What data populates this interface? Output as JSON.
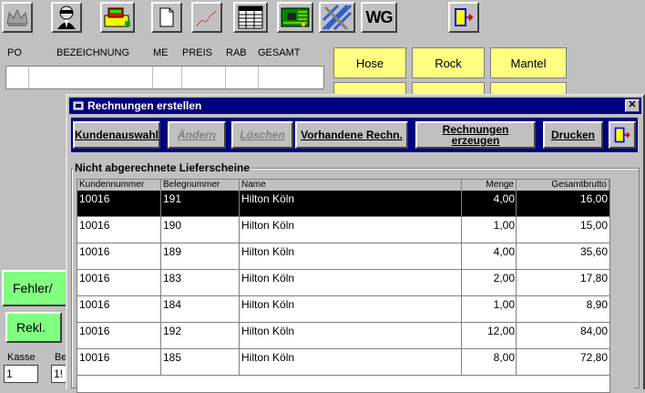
{
  "toolbar": {
    "icons": [
      "crown-icon",
      "agent-icon",
      "cash-register-icon",
      "document-icon",
      "chart-icon",
      "spreadsheet-icon",
      "circuit-icon",
      "layout-icon",
      "wg-button",
      "exit-door-icon"
    ],
    "wg_label": "WG"
  },
  "order_table": {
    "headers": [
      "PO",
      "BEZEICHNUNG",
      "ME",
      "PREIS",
      "RAB",
      "GESAMT"
    ]
  },
  "products": [
    "Hose",
    "Rock",
    "Mantel"
  ],
  "left_panel": {
    "fehler_label": "Fehler/",
    "rekl_label": "Rekl.",
    "kasse_label": "Kasse",
    "be_label": "Be",
    "kasse_value": "1",
    "be_value": "1!"
  },
  "dialog": {
    "title": "Rechnungen erstellen",
    "close_label": "✕",
    "buttons": {
      "kundenauswahl": "Kundenauswahl",
      "aendern": "Ändern",
      "loeschen": "Löschen",
      "vorhandene": "Vorhandene Rechn.",
      "erzeugen_1": "Rechnungen",
      "erzeugen_2": "erzeugen",
      "drucken": "Drucken"
    },
    "group_label": "Nicht abgerechnete Lieferscheine",
    "columns": [
      "Kundennummer",
      "Belegnummer",
      "Name",
      "Menge",
      "Gesamtbrutto"
    ],
    "rows": [
      {
        "kunde": "10016",
        "beleg": "191",
        "name": "Hilton Köln",
        "menge": "4,00",
        "brutto": "16,00"
      },
      {
        "kunde": "10016",
        "beleg": "190",
        "name": "Hilton Köln",
        "menge": "1,00",
        "brutto": "15,00"
      },
      {
        "kunde": "10016",
        "beleg": "189",
        "name": "Hilton Köln",
        "menge": "4,00",
        "brutto": "35,60"
      },
      {
        "kunde": "10016",
        "beleg": "183",
        "name": "Hilton Köln",
        "menge": "2,00",
        "brutto": "17,80"
      },
      {
        "kunde": "10016",
        "beleg": "184",
        "name": "Hilton Köln",
        "menge": "1,00",
        "brutto": "8,90"
      },
      {
        "kunde": "10016",
        "beleg": "192",
        "name": "Hilton Köln",
        "menge": "12,00",
        "brutto": "84,00"
      },
      {
        "kunde": "10016",
        "beleg": "185",
        "name": "Hilton Köln",
        "menge": "8,00",
        "brutto": "72,80"
      }
    ]
  }
}
